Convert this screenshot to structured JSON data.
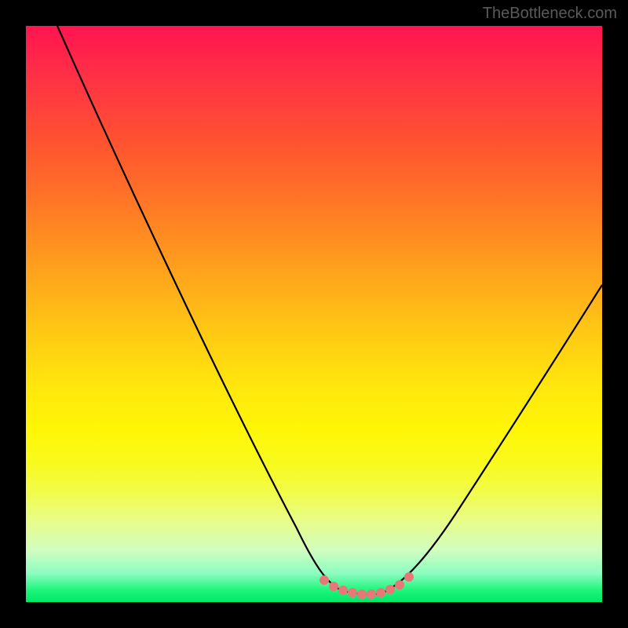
{
  "watermark": "TheBottleneck.com",
  "chart_data": {
    "type": "line",
    "title": "",
    "xlabel": "",
    "ylabel": "",
    "xlim": [
      0,
      100
    ],
    "ylim": [
      0,
      100
    ],
    "series": [
      {
        "name": "bottleneck-curve",
        "x": [
          0,
          10,
          20,
          30,
          40,
          47,
          52,
          55,
          58,
          62,
          66,
          72,
          80,
          90,
          100
        ],
        "values": [
          100,
          82,
          63,
          45,
          27,
          12,
          4,
          1,
          0.5,
          1,
          4,
          12,
          25,
          41,
          57
        ]
      }
    ],
    "markers": {
      "name": "salmon-dots",
      "color": "#e87878",
      "x": [
        52,
        53.5,
        55,
        56.5,
        58,
        59.5,
        61,
        62.5,
        64,
        65.5
      ],
      "values": [
        2.8,
        1.8,
        1.2,
        0.8,
        0.6,
        0.7,
        1.0,
        1.6,
        2.4,
        3.4
      ]
    },
    "gradient_stops": [
      {
        "pos": 0,
        "color": "#ff1450"
      },
      {
        "pos": 50,
        "color": "#ffc814"
      },
      {
        "pos": 100,
        "color": "#00e868"
      }
    ]
  }
}
